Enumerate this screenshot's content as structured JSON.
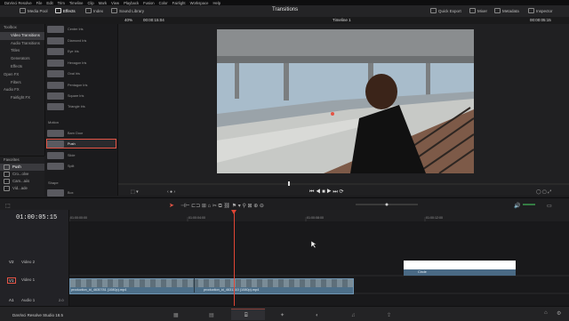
{
  "app": {
    "name": "DaVinci Resolve",
    "version_label": "DaVinci Resolve Studio 18.5"
  },
  "menu": [
    "DaVinci Resolve",
    "File",
    "Edit",
    "Trim",
    "Timeline",
    "Clip",
    "Mark",
    "View",
    "Playback",
    "Fusion",
    "Color",
    "Fairlight",
    "Workspace",
    "Help"
  ],
  "toolbar": {
    "left": [
      "Media Pool",
      "Effects",
      "Index",
      "Sound Library"
    ],
    "title": "Transitions",
    "right": [
      "Quick Export",
      "Mixer",
      "Metadata",
      "Inspector"
    ]
  },
  "viewer": {
    "zoom": "40%",
    "timecode_left": "00:00:15:04",
    "timeline_name": "Timeline 1",
    "timecode_right": "00:00:05:15"
  },
  "toolbox": {
    "items": [
      "Toolbox",
      "Video Transitions",
      "Audio Transitions",
      "Titles",
      "Generators",
      "Effects",
      "Open FX",
      "Filters",
      "Audio FX",
      "Fairlight FX"
    ],
    "selected_index": 1
  },
  "transitions": {
    "top_items": [
      "Center Iris",
      "Diamond Iris",
      "Eye Iris",
      "Hexagon Iris",
      "Oval Iris",
      "Pentagon Iris",
      "Square Iris",
      "Triangle Iris"
    ],
    "motion_header": "Motion",
    "motion_items": [
      "Barn Door",
      "Push",
      "Slide",
      "Split"
    ],
    "selected": "Push",
    "shape_header": "Shape",
    "shape_items": [
      "Box"
    ]
  },
  "favorites": {
    "header": "Favorites",
    "items": [
      "Push",
      "Cro...olve",
      "Cam...aiis",
      "Vid...ade"
    ]
  },
  "timeline": {
    "timecode": "01:00:05:15",
    "ruler": [
      "01:00:00:00",
      "01:00:04:00",
      "01:00:08:00",
      "01:00:12:00"
    ],
    "tracks": [
      {
        "id": "V2",
        "name": "Video 2"
      },
      {
        "id": "V1",
        "name": "Video 1"
      },
      {
        "id": "A1",
        "name": "Audio 1",
        "level": "2.0"
      }
    ],
    "clips": [
      {
        "label": "production_id_4630781 (1080p).mp4"
      },
      {
        "label": "production_id_4631310 (1080p).mp4"
      }
    ],
    "title_clip": "Circle"
  },
  "colors": {
    "accent_red": "#e45445",
    "clip_blue": "#4d6f89",
    "playhead": "#e04535"
  }
}
